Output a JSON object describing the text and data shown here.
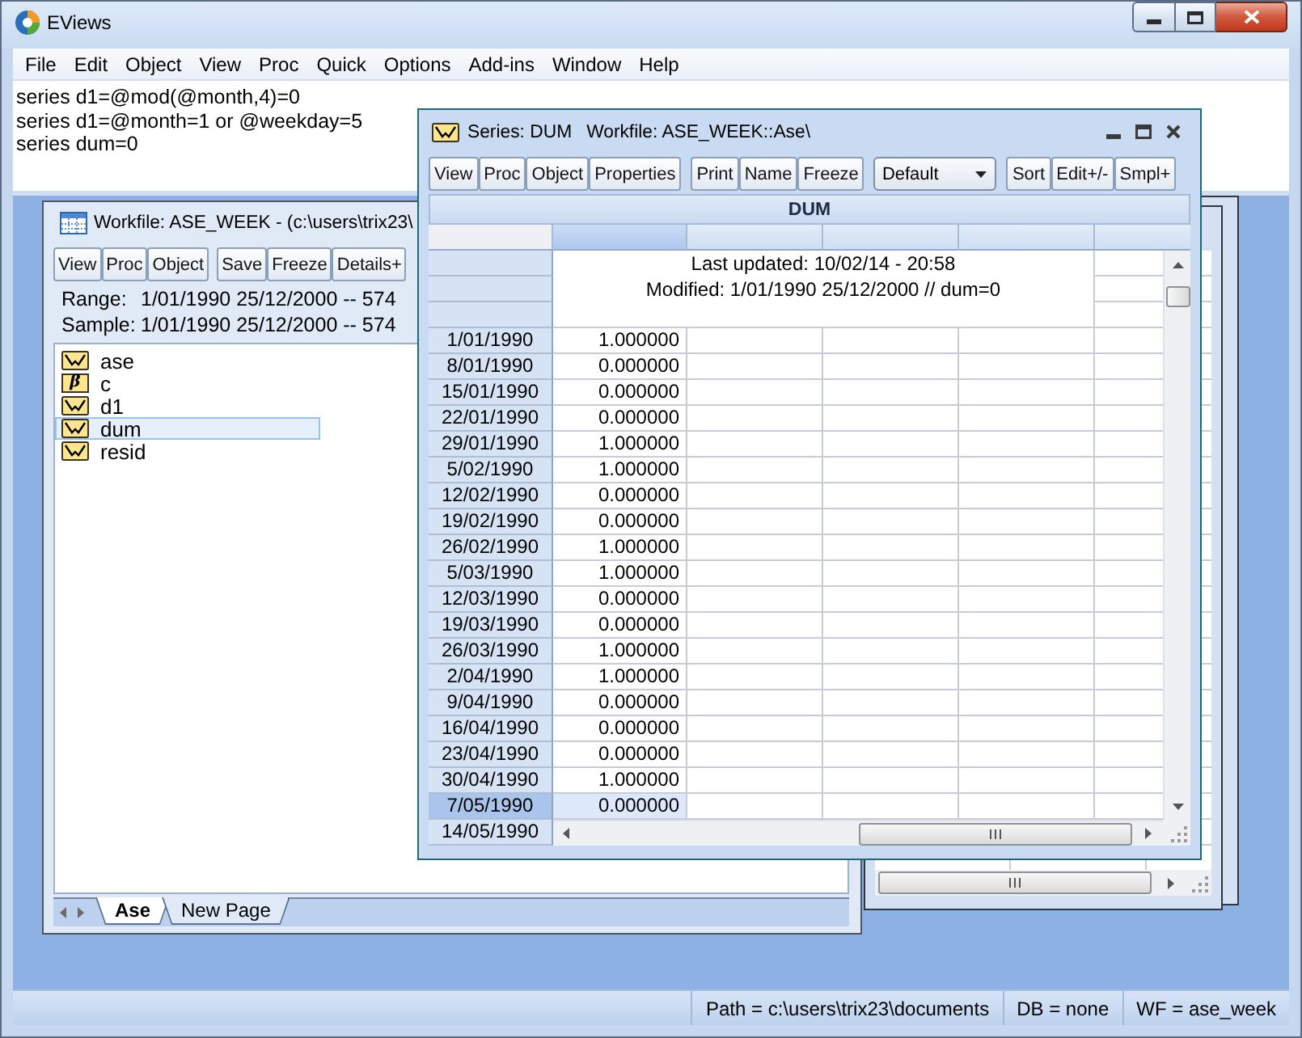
{
  "window": {
    "title": "EViews"
  },
  "menu": [
    "File",
    "Edit",
    "Object",
    "View",
    "Proc",
    "Quick",
    "Options",
    "Add-ins",
    "Window",
    "Help"
  ],
  "command_lines": [
    "series d1=@mod(@month,4)=0",
    "series d1=@month=1 or @weekday=5",
    "series dum=0"
  ],
  "workfile_window": {
    "title": "Workfile: ASE_WEEK - (c:\\users\\trix23\\",
    "toolbar": [
      [
        "View",
        "Proc",
        "Object"
      ],
      [
        "Save",
        "Freeze",
        "Details+"
      ]
    ],
    "info_lines": [
      {
        "label": "Range:",
        "value": "1/01/1990 25/12/2000 -- 574"
      },
      {
        "label": "Sample:",
        "value": "1/01/1990 25/12/2000 -- 574"
      }
    ],
    "objects": [
      {
        "name": "ase",
        "kind": "series",
        "selected": false
      },
      {
        "name": "c",
        "kind": "coef",
        "symbol": "β",
        "selected": false
      },
      {
        "name": "d1",
        "kind": "series",
        "selected": false
      },
      {
        "name": "dum",
        "kind": "series",
        "selected": true
      },
      {
        "name": "resid",
        "kind": "series",
        "selected": false
      }
    ],
    "page_tabs": [
      {
        "label": "Ase",
        "selected": true
      },
      {
        "label": "New Page",
        "selected": false
      }
    ]
  },
  "series_window": {
    "title": "Series: DUM",
    "subtitle": "Workfile: ASE_WEEK::Ase\\",
    "toolbar": [
      [
        "View",
        "Proc",
        "Object",
        "Properties"
      ],
      [
        "Print",
        "Name",
        "Freeze"
      ]
    ],
    "view_select": {
      "value": "Default"
    },
    "toolbar_right": [
      "Sort",
      "Edit+/-",
      "Smpl+"
    ],
    "header": "DUM",
    "columns": [
      {
        "selected": true
      },
      {
        "selected": false
      },
      {
        "selected": false
      },
      {
        "selected": false
      },
      {
        "selected": false
      }
    ],
    "notes": [
      "Last updated: 10/02/14 - 20:58",
      "Modified: 1/01/1990 25/12/2000 // dum=0"
    ],
    "rows": [
      {
        "date": "1/01/1990",
        "value": "1.000000",
        "selected": false
      },
      {
        "date": "8/01/1990",
        "value": "0.000000",
        "selected": false
      },
      {
        "date": "15/01/1990",
        "value": "0.000000",
        "selected": false
      },
      {
        "date": "22/01/1990",
        "value": "0.000000",
        "selected": false
      },
      {
        "date": "29/01/1990",
        "value": "1.000000",
        "selected": false
      },
      {
        "date": "5/02/1990",
        "value": "1.000000",
        "selected": false
      },
      {
        "date": "12/02/1990",
        "value": "0.000000",
        "selected": false
      },
      {
        "date": "19/02/1990",
        "value": "0.000000",
        "selected": false
      },
      {
        "date": "26/02/1990",
        "value": "1.000000",
        "selected": false
      },
      {
        "date": "5/03/1990",
        "value": "1.000000",
        "selected": false
      },
      {
        "date": "12/03/1990",
        "value": "0.000000",
        "selected": false
      },
      {
        "date": "19/03/1990",
        "value": "0.000000",
        "selected": false
      },
      {
        "date": "26/03/1990",
        "value": "1.000000",
        "selected": false
      },
      {
        "date": "2/04/1990",
        "value": "1.000000",
        "selected": false
      },
      {
        "date": "9/04/1990",
        "value": "0.000000",
        "selected": false
      },
      {
        "date": "16/04/1990",
        "value": "0.000000",
        "selected": false
      },
      {
        "date": "23/04/1990",
        "value": "0.000000",
        "selected": false
      },
      {
        "date": "30/04/1990",
        "value": "1.000000",
        "selected": false
      },
      {
        "date": "7/05/1990",
        "value": "0.000000",
        "selected": true
      },
      {
        "date": "14/05/1990",
        "selected": false
      }
    ]
  },
  "status_bar": [
    "Path = c:\\users\\trix23\\documents",
    "DB = none",
    "WF = ase_week"
  ]
}
